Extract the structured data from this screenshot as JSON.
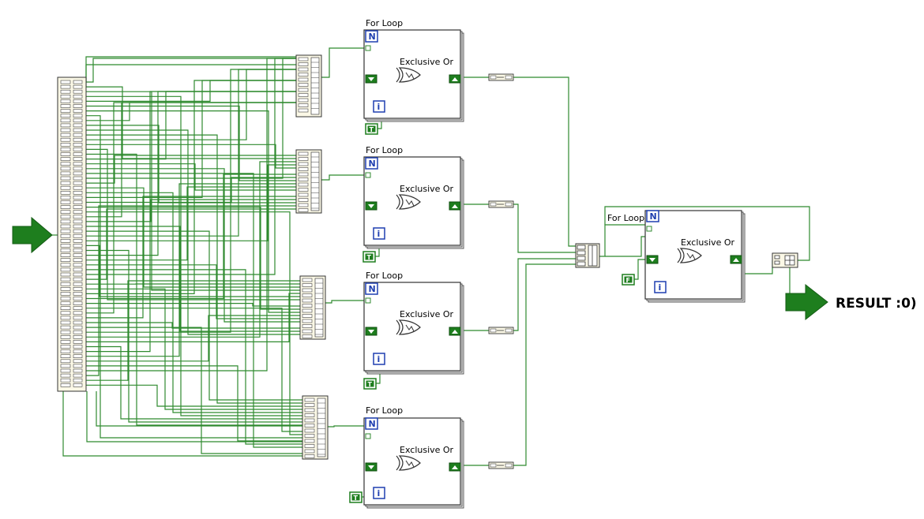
{
  "loops": [
    {
      "label": "For Loop",
      "xor_label": "Exclusive Or",
      "count_terminal": "N",
      "iteration_terminal": "i",
      "constant": "T"
    },
    {
      "label": "For Loop",
      "xor_label": "Exclusive Or",
      "count_terminal": "N",
      "iteration_terminal": "i",
      "constant": "T"
    },
    {
      "label": "For Loop",
      "xor_label": "Exclusive Or",
      "count_terminal": "N",
      "iteration_terminal": "i",
      "constant": "T"
    },
    {
      "label": "For Loop",
      "xor_label": "Exclusive Or",
      "count_terminal": "N",
      "iteration_terminal": "i",
      "constant": "T"
    }
  ],
  "final_loop": {
    "label": "For Loop",
    "xor_label": "Exclusive Or",
    "count_terminal": "N",
    "iteration_terminal": "i",
    "constant": "F"
  },
  "result": {
    "label": "RESULT :0)"
  },
  "colors": {
    "wire": "#2f8a2f",
    "node_fill": "#fbf8e6",
    "terminal_green": "#1e7e1e",
    "terminal_blue": "#1f3fb0"
  },
  "icons": {
    "input_arrow": "arrow-right-icon",
    "output_arrow": "arrow-right-icon",
    "xor_gate": "xor-gate-icon"
  }
}
